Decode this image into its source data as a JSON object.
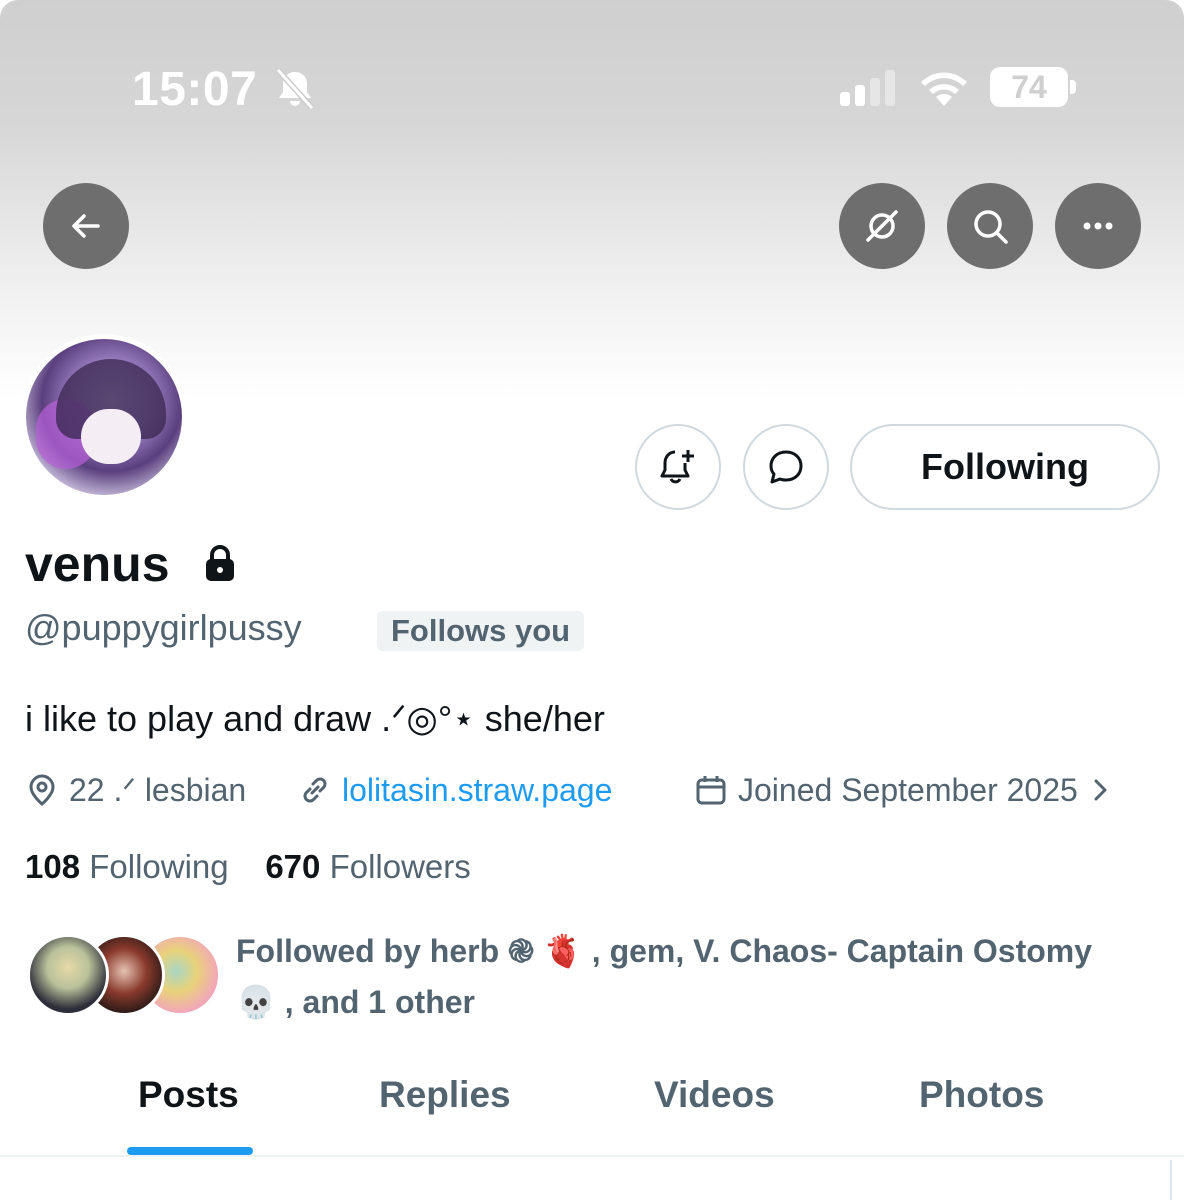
{
  "status_bar": {
    "time": "15:07",
    "battery": "74",
    "icons": [
      "bell-off-icon",
      "signal-icon",
      "wifi-icon",
      "battery-icon"
    ]
  },
  "header": {
    "buttons": [
      "back-arrow-icon",
      "grok-icon",
      "search-icon",
      "more-icon"
    ]
  },
  "profile": {
    "display_name": "venus",
    "handle": "@puppygirlpussy",
    "follows_you": "Follows you",
    "bio": "i like to play and draw .ᐟ◎°⋆ she/her",
    "location": "22 .ᐟ lesbian",
    "website": "lolitasin.straw.page",
    "joined": "Joined September 2025",
    "following_count": "108",
    "following_label": "Following",
    "followers_count": "670",
    "followers_label": "Followers",
    "followed_by_line1": "Followed by herb ֎ 🫀 , gem, V. Chaos- Captain Ostomy",
    "followed_by_line2": "💀 , and 1 other"
  },
  "actions": {
    "following_button": "Following"
  },
  "tabs": [
    "Posts",
    "Replies",
    "Videos",
    "Photos"
  ],
  "active_tab": "Posts",
  "colors": {
    "accent": "#1d9bf0",
    "text_primary": "#0f1419",
    "text_secondary": "#536471",
    "header_button": "#6e6e6e"
  }
}
